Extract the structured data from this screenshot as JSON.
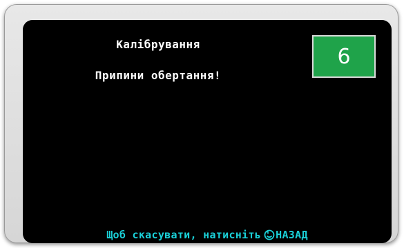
{
  "screen": {
    "title": "Калібрування",
    "message": "Припини обертання!",
    "counter": "6"
  },
  "footer": {
    "prefix": "Щоб скасувати, натисніть",
    "back_icon": "back-arrow-circle-icon",
    "back_label": "НАЗАД"
  },
  "colors": {
    "screen_background": "#000000",
    "counter_background": "#1fa34a",
    "footer_text": "#1ad0d8",
    "text": "#ffffff"
  }
}
